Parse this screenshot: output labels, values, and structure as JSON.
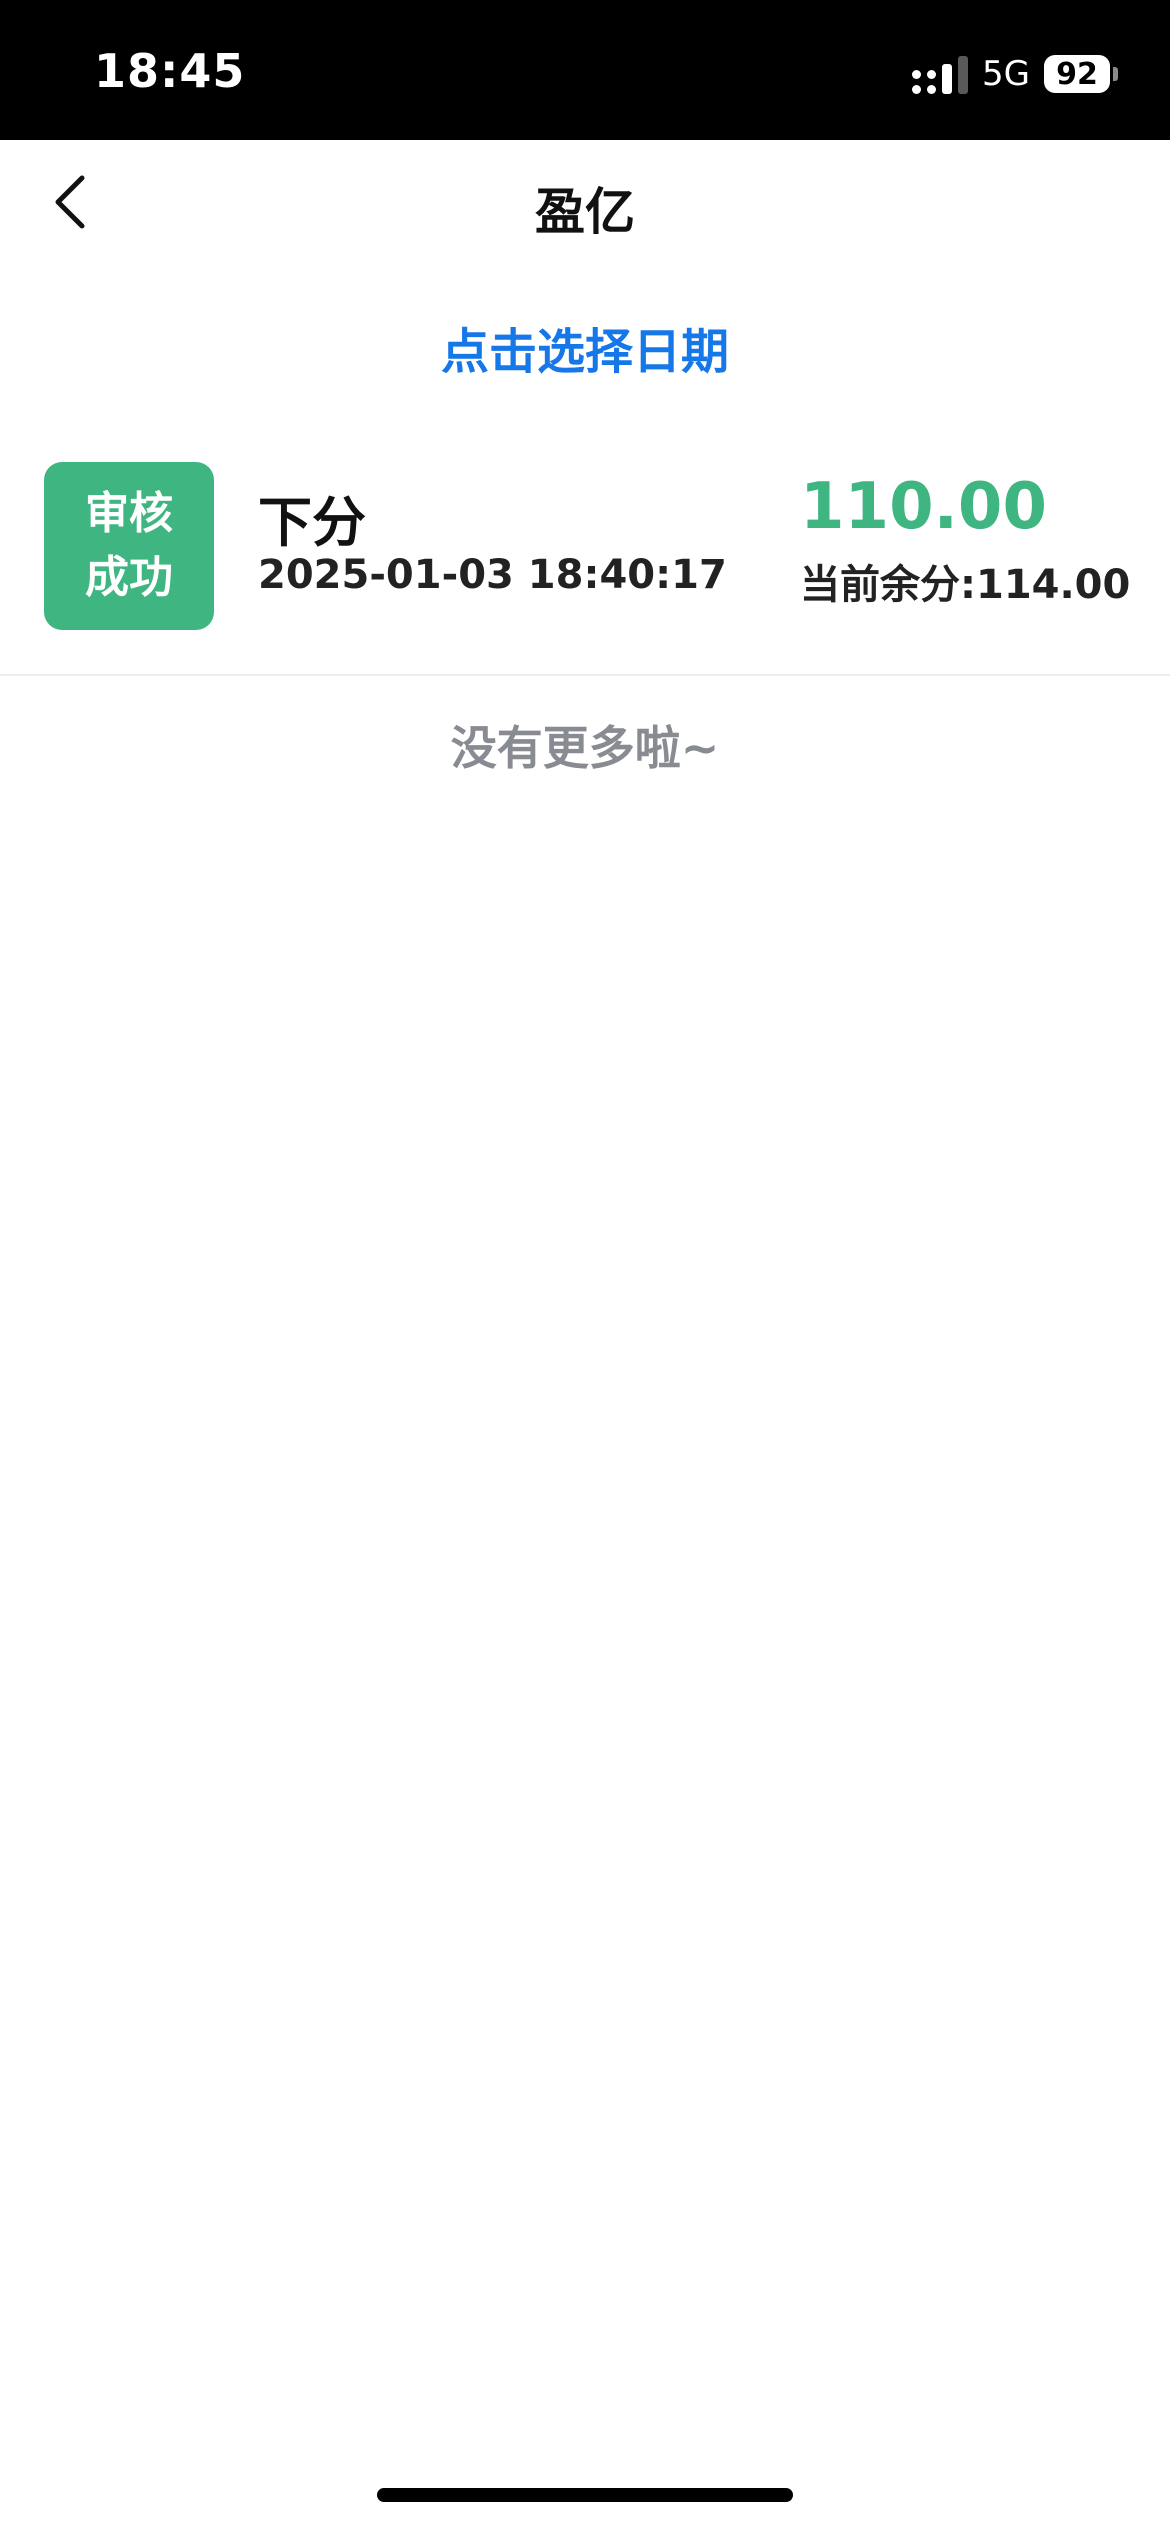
{
  "status_bar": {
    "time": "18:45",
    "network": "5G",
    "battery": "92"
  },
  "nav": {
    "title": "盈亿",
    "back_icon": "chevron-left-icon"
  },
  "date_picker": {
    "label": "点击选择日期"
  },
  "records": [
    {
      "status_line1": "审核",
      "status_line2": "成功",
      "status_color": "#3fb681",
      "type": "下分",
      "datetime": "2025-01-03 18:40:17",
      "amount": "110.00",
      "balance": "当前余分:114.00"
    }
  ],
  "footer": {
    "no_more": "没有更多啦~"
  },
  "colors": {
    "accent_blue": "#1677e8",
    "success_green": "#3fb681",
    "muted_gray": "#888b91"
  }
}
